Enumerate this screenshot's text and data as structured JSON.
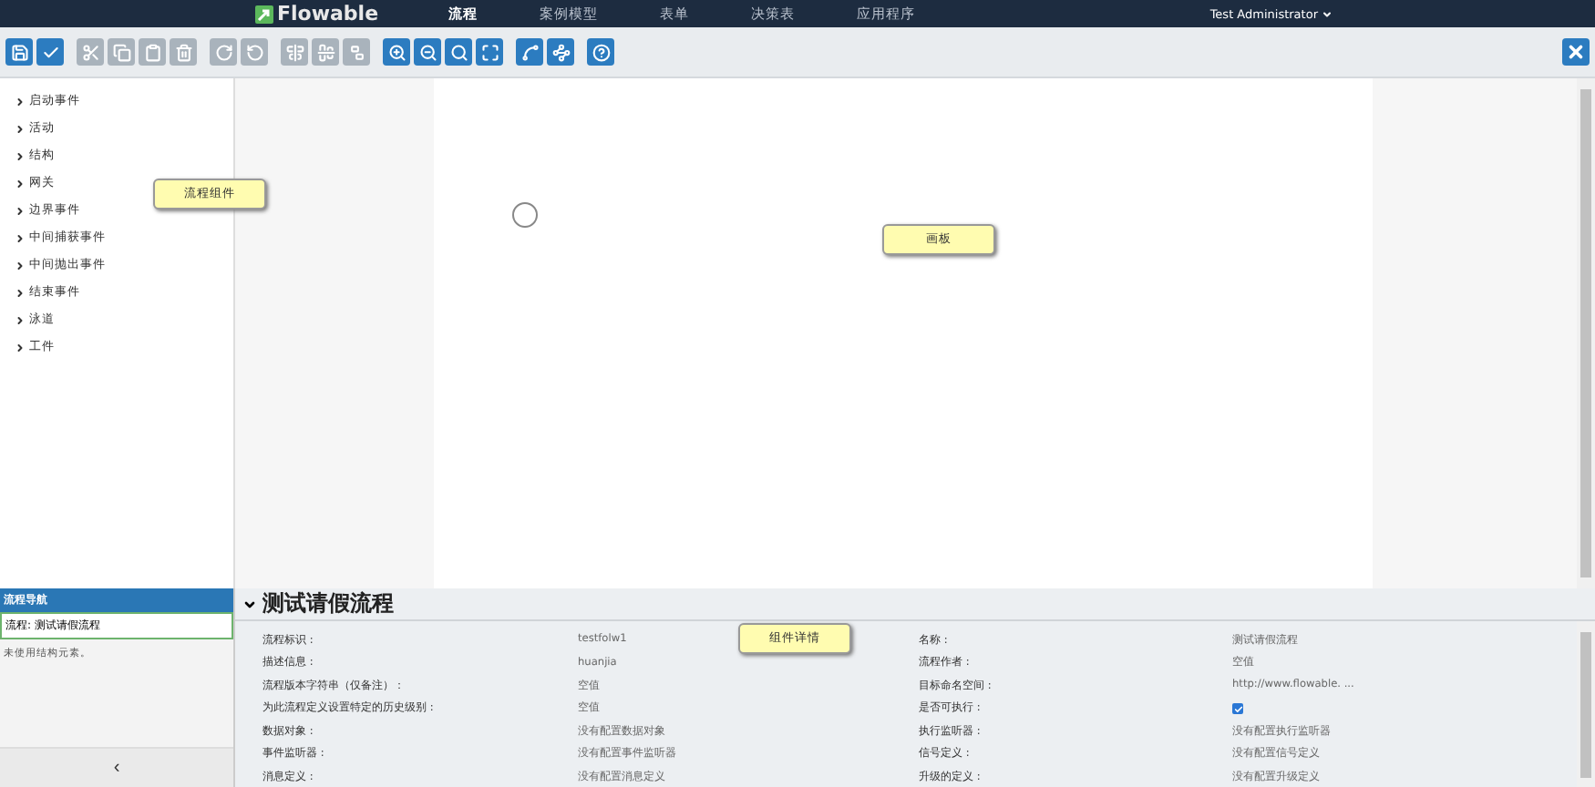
{
  "nav": {
    "logo": "Flowable",
    "items": [
      {
        "label": "流程",
        "selected": true
      },
      {
        "label": "案例模型",
        "selected": false
      },
      {
        "label": "表单",
        "selected": false
      },
      {
        "label": "决策表",
        "selected": false
      },
      {
        "label": "应用程序",
        "selected": false
      }
    ],
    "user": "Test Administrator"
  },
  "toolbar": {
    "groups": [
      [
        {
          "disabled": false
        },
        {
          "disabled": false
        }
      ],
      [
        {
          "disabled": true
        },
        {
          "disabled": true
        },
        {
          "disabled": true
        },
        {
          "disabled": true
        }
      ],
      [
        {
          "disabled": true
        },
        {
          "disabled": true
        }
      ],
      [
        {
          "disabled": true
        },
        {
          "disabled": true
        },
        {
          "disabled": true
        }
      ],
      [
        {
          "disabled": false
        },
        {
          "disabled": false
        },
        {
          "disabled": false
        },
        {
          "disabled": false
        }
      ],
      [
        {
          "disabled": false
        },
        {
          "disabled": false
        }
      ],
      [
        {
          "disabled": false
        }
      ]
    ]
  },
  "palette": {
    "items": [
      "启动事件",
      "活动",
      "结构",
      "网关",
      "边界事件",
      "中间捕获事件",
      "中间抛出事件",
      "结束事件",
      "泳道",
      "工件"
    ]
  },
  "callouts": [
    {
      "text": "流程组件",
      "kind": "palette"
    },
    {
      "text": "画板",
      "kind": "canvas"
    },
    {
      "text": "组件详情",
      "kind": "details"
    }
  ],
  "navigator": {
    "title": "流程导航",
    "current": "流程: 测试请假流程",
    "message": "未使用结构元素。",
    "collapse": "‹"
  },
  "details": {
    "title": "测试请假流程",
    "left": [
      {
        "label": "流程标识 :",
        "value": "testfolw1"
      },
      {
        "label": "描述信息 :",
        "value": "huanjia"
      },
      {
        "label": "流程版本字符串（仅备注）：",
        "value": "空值"
      },
      {
        "label": "为此流程定义设置特定的历史级别 :",
        "value": "空值"
      },
      {
        "label": "数据对象 :",
        "value": "没有配置数据对象"
      },
      {
        "label": "事件监听器 :",
        "value": "没有配置事件监听器"
      },
      {
        "label": "消息定义 :",
        "value": "没有配置消息定义"
      }
    ],
    "right": [
      {
        "label": "名称 :",
        "kind": "text",
        "value": "测试请假流程"
      },
      {
        "label": "流程作者 :",
        "kind": "text",
        "value": "空值"
      },
      {
        "label": "目标命名空间 :",
        "kind": "text",
        "value": "http://www.flowable. ..."
      },
      {
        "label": "是否可执行 :",
        "kind": "checkbox",
        "checked": true
      },
      {
        "label": "执行监听器 :",
        "kind": "text",
        "value": "没有配置执行监听器"
      },
      {
        "label": "信号定义 :",
        "kind": "text",
        "value": "没有配置信号定义"
      },
      {
        "label": "升级的定义 :",
        "kind": "text",
        "value": "没有配置升级定义"
      }
    ]
  }
}
